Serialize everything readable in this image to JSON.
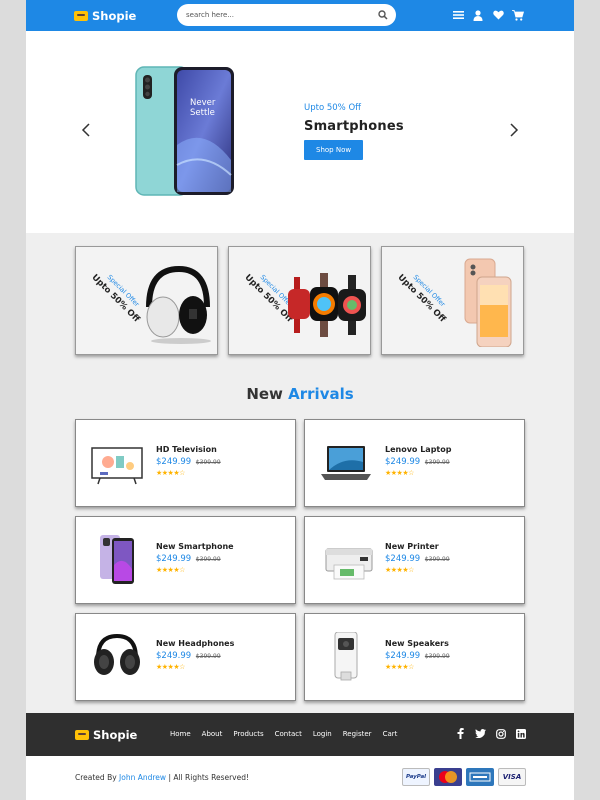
{
  "brand": {
    "name": "Shopie"
  },
  "header": {
    "search_placeholder": "search here...",
    "icons": [
      "menu-icon",
      "user-icon",
      "heart-icon",
      "cart-icon"
    ]
  },
  "hero": {
    "offer": "Upto 50% Off",
    "title": "Smartphones",
    "button": "Shop Now",
    "image_text_line1": "Never",
    "image_text_line2": "Settle"
  },
  "offers": [
    {
      "special": "Special Offer",
      "discount": "Upto 50% Off",
      "image": "headphones"
    },
    {
      "special": "Special Offer",
      "discount": "Upto 50% Off",
      "image": "smartwatches"
    },
    {
      "special": "Special Offer",
      "discount": "Upto 50% Off",
      "image": "smartphone"
    }
  ],
  "new_arrivals": {
    "title_plain": "New",
    "title_accent": "Arrivals",
    "products": [
      {
        "name": "HD Television",
        "price": "$249.99",
        "old_price": "$399.99",
        "rating": "★★★★☆"
      },
      {
        "name": "Lenovo Laptop",
        "price": "$249.99",
        "old_price": "$399.99",
        "rating": "★★★★☆"
      },
      {
        "name": "New Smartphone",
        "price": "$249.99",
        "old_price": "$399.99",
        "rating": "★★★★☆"
      },
      {
        "name": "New Printer",
        "price": "$249.99",
        "old_price": "$399.99",
        "rating": "★★★★☆"
      },
      {
        "name": "New Headphones",
        "price": "$249.99",
        "old_price": "$399.99",
        "rating": "★★★★☆"
      },
      {
        "name": "New Speakers",
        "price": "$249.99",
        "old_price": "$399.99",
        "rating": "★★★★☆"
      }
    ]
  },
  "footer": {
    "nav": [
      "Home",
      "About",
      "Products",
      "Contact",
      "Login",
      "Register",
      "Cart"
    ],
    "social": [
      "facebook-icon",
      "twitter-icon",
      "instagram-icon",
      "linkedin-icon"
    ],
    "credit_prefix": "Created By",
    "credit_author": "John Andrew",
    "credit_suffix": "| All Rights Reserved!",
    "payments": [
      "PayPal",
      "MasterCard",
      "American Express",
      "VISA"
    ]
  },
  "colors": {
    "accent": "#1e88e5",
    "footer": "#2f2f2f",
    "stars": "#ffb300"
  }
}
